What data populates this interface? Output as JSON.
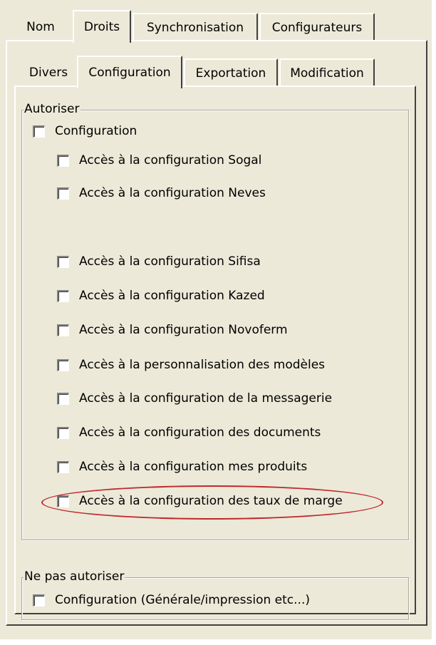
{
  "outer_tabs": [
    "Nom",
    "Droits",
    "Synchronisation",
    "Configurateurs"
  ],
  "inner_tabs": [
    "Divers",
    "Configuration",
    "Exportation",
    "Modification"
  ],
  "autoriser": {
    "title": "Autoriser",
    "master": "Configuration",
    "items": [
      "Accès à la configuration Sogal",
      "Accès à la configuration Neves",
      "Accès à la configuration Sifisa",
      "Accès à la configuration Kazed",
      "Accès à la configuration Novoferm",
      "Accès à la personnalisation des modèles",
      "Accès à la configuration de la messagerie",
      "Accès à la configuration des documents",
      "Accès à la configuration mes produits",
      "Accès à la configuration des taux de marge"
    ]
  },
  "ne_pas_autoriser": {
    "title": "Ne pas autoriser",
    "item": "Configuration (Générale/impression etc...)"
  },
  "colors": {
    "highlight_ellipse": "#c0282d",
    "panel": "#ece9d8"
  }
}
